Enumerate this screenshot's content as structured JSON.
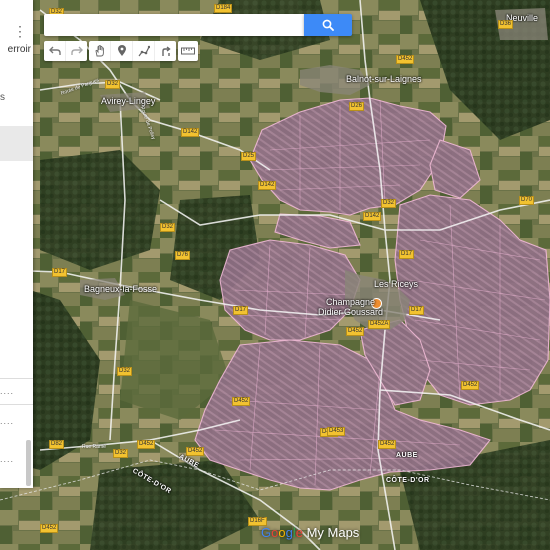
{
  "panel": {
    "title_fragment": "erroir",
    "s_fragment": "s",
    "menu_icon": "kebab-menu-icon",
    "row_dots": [
      "....",
      "....",
      "...."
    ]
  },
  "search": {
    "placeholder": "",
    "value": "",
    "button_icon": "magnifier-icon"
  },
  "toolbar": {
    "tools": [
      "undo-icon",
      "redo-icon",
      "pan-hand-icon",
      "add-marker-icon",
      "draw-line-icon",
      "directions-icon",
      "measure-ruler-icon"
    ]
  },
  "places": [
    {
      "name": "Avirey-Lingey"
    },
    {
      "name": "Balnot-sur-Laignes"
    },
    {
      "name": "Bagneux-la-Fosse"
    },
    {
      "name": "Les Riceys"
    },
    {
      "name": "Neuville"
    }
  ],
  "poi": {
    "name": "Champagne Didier Goussard",
    "line1": "Champagne",
    "line2": "Didier Goussard",
    "color": "#ee8d2f"
  },
  "roads": [
    "D32",
    "D184",
    "D36",
    "D452",
    "D26",
    "D142",
    "D142",
    "D142",
    "D25",
    "D70",
    "D32",
    "D17",
    "D76",
    "D17",
    "D452",
    "D17",
    "D452A",
    "D32",
    "D32",
    "D452",
    "D452",
    "D452",
    "D453",
    "D452",
    "D82",
    "D452",
    "D32",
    "D17",
    "D452",
    "D17",
    "D16F",
    "D452",
    "D32"
  ],
  "departments": [
    "AUBE",
    "AUBE",
    "CÔTE-D'OR",
    "CÔTE-D'OR"
  ],
  "minor_labels": [
    "Route de Pargues",
    "Route de Polisy",
    "Rue Ramé"
  ],
  "vineyard_color": "#c08aa8",
  "vineyard_outline": "#f0b8d8",
  "branding": {
    "google": "Google",
    "mymaps": " My Maps"
  }
}
